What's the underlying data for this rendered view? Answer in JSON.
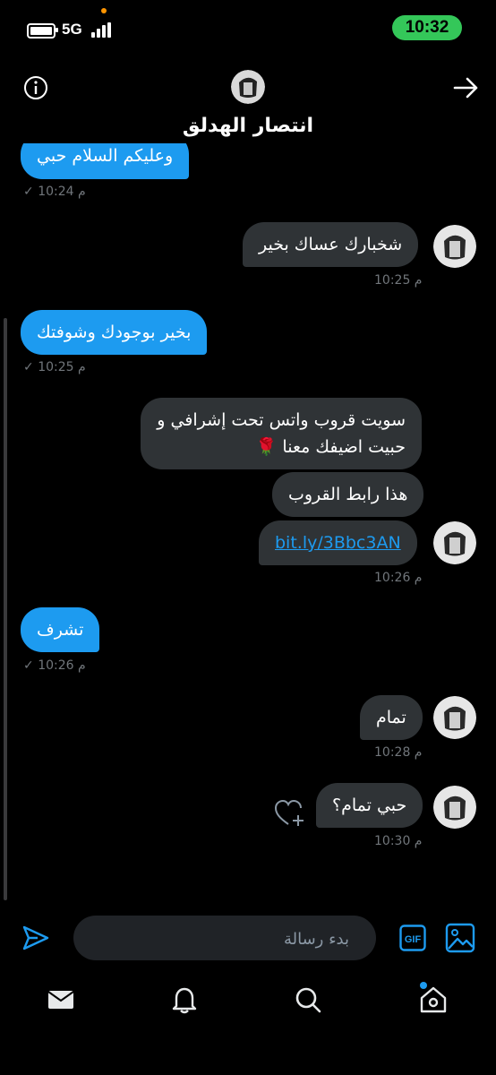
{
  "status_bar": {
    "time": "10:32",
    "network": "5G"
  },
  "header": {
    "title": "انتصار الهدلق"
  },
  "messages": [
    {
      "text": "وعليكم السلام حبي",
      "time": "10:24 م",
      "check": "✓"
    },
    {
      "text": "شخبارك عساك بخير",
      "time": "10:25 م"
    },
    {
      "text": "بخير بوجودك وشوفتك",
      "time": "10:25 م",
      "check": "✓"
    },
    {
      "line1": "سويت قروب واتس تحت إشرافي و",
      "line2": "حبيت اضيفك معنا 🌹"
    },
    {
      "text": "هذا رابط القروب"
    },
    {
      "text": "bit.ly/3Bbc3AN",
      "time": "10:26 م"
    },
    {
      "text": "تشرف",
      "time": "10:26 م",
      "check": "✓"
    },
    {
      "text": "تمام",
      "time": "10:28 م"
    },
    {
      "text": "حبي تمام؟",
      "time": "10:30 م"
    }
  ],
  "composer": {
    "placeholder": "بدء رسالة",
    "gif_label": "GIF"
  },
  "colors": {
    "sent_bubble": "#1d9bf0",
    "received_bubble": "#2f3336",
    "status_pill": "#34c759",
    "background": "#000000"
  }
}
